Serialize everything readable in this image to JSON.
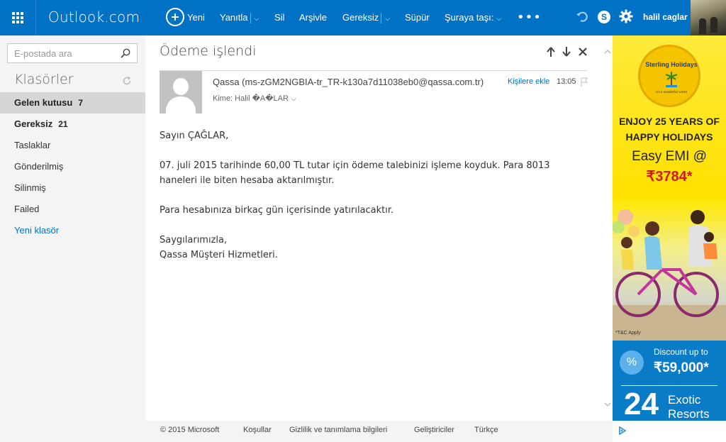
{
  "topbar": {
    "app_title": "Outlook.com",
    "new_label": "Yeni",
    "reply_label": "Yanıtla",
    "delete_label": "Sil",
    "archive_label": "Arşivle",
    "junk_label": "Gereksiz",
    "sweep_label": "Süpür",
    "move_label": "Şuraya taşı:",
    "username": "halil caglar"
  },
  "search": {
    "placeholder": "E-postada ara"
  },
  "folders": {
    "title": "Klasörler",
    "items": [
      {
        "label": "Gelen kutusu",
        "count": "7"
      },
      {
        "label": "Gereksiz",
        "count": "21"
      },
      {
        "label": "Taslaklar"
      },
      {
        "label": "Gönderilmiş"
      },
      {
        "label": "Silinmiş"
      },
      {
        "label": "Failed"
      }
    ],
    "new_folder": "Yeni klasör"
  },
  "message": {
    "subject": "Ödeme işlendi",
    "sender": "Qassa (ms-zGM2NGBIA-tr_TR-k130a7d11038eb0@qassa.com.tr)",
    "add_contact": "Kişilere ekle",
    "time": "13:05",
    "to": "Kime: Halil �A�LAR",
    "body": [
      "Sayın ÇAĞLAR,",
      "07. juli 2015 tarihinde 60,00 TL tutar için ödeme talebinizi işleme koyduk. Para 8013 haneleri ile biten hesaba aktarılmıştır.",
      "Para hesabınıza birkaç gün içerisinde yatırılacaktır.",
      "Saygılarımızla,",
      "Qassa Müşteri Hizmetleri."
    ]
  },
  "footer": {
    "copyright": "© 2015 Microsoft",
    "terms": "Koşullar",
    "privacy": "Gizlilik ve tanımlama bilgileri",
    "developers": "Geliştiriciler",
    "language": "Türkçe"
  },
  "ad": {
    "brand": "Sterling Holidays",
    "tagline": "it's a wonderful world",
    "headline_1": "ENJOY 25 YEARS OF",
    "headline_2": "HAPPY HOLIDAYS",
    "emi": "Easy EMI @",
    "price": "₹3784*",
    "tc": "*T&C Apply",
    "discount": "Discount up to",
    "discount_amount": "₹59,000*",
    "big_number": "24",
    "exotic_1": "Exotic",
    "exotic_2": "Resorts"
  },
  "colors": {
    "brand_blue": "#0072c6",
    "nav_bg": "#f4f4f4",
    "selected_bg": "#d6d6d6",
    "link_blue": "#0072c6"
  }
}
